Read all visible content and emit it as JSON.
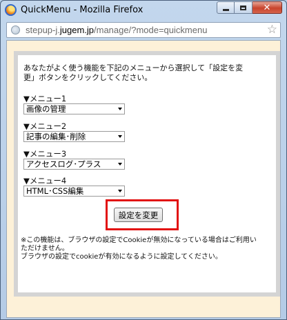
{
  "window": {
    "title": "QuickMenu - Mozilla Firefox",
    "url_prefix": "stepup-j.",
    "url_host": "jugem.jp",
    "url_path": "/manage/?mode=quickmenu"
  },
  "page": {
    "intro_line1": "あなたがよく使う機能を下記のメニューから選択して「設定を変",
    "intro_line2": "更」ボタンをクリックしてください。",
    "menus": [
      {
        "label": "▼メニュー1",
        "value": "画像の管理"
      },
      {
        "label": "▼メニュー2",
        "value": "記事の編集･削除"
      },
      {
        "label": "▼メニュー3",
        "value": "アクセスログ･プラス"
      },
      {
        "label": "▼メニュー4",
        "value": "HTML･CSS編集"
      }
    ],
    "submit_label": "設定を変更",
    "note_line1": "※この機能は、ブラウザの設定でCookieが無効になっている場合はご利用い",
    "note_line2": "ただけません。",
    "note_line3": "ブラウザの設定でcookieが有効になるように設定してください。"
  },
  "colors": {
    "highlight": "#e21010",
    "content_background": "#fdf1d8"
  },
  "icons": [
    "firefox-icon",
    "minimize-icon",
    "maximize-icon",
    "close-icon",
    "globe-icon",
    "bookmark-star-icon",
    "dropdown-caret-icon"
  ]
}
